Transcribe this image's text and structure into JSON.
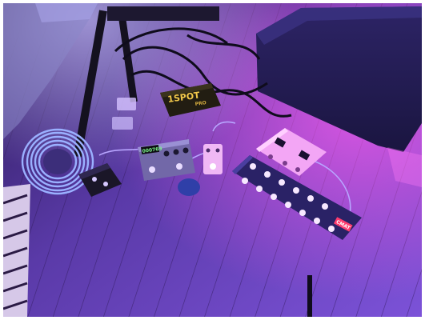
{
  "photo": {
    "subject": "pedalboard",
    "labels": {
      "power_supply": "1SPOT",
      "power_supply_sub": "PRO",
      "delay_display": "000769",
      "switcher_brand": "CMAT"
    },
    "colors": {
      "floor_dark": "#3b2277",
      "floor_light": "#7a4fd6",
      "magenta_glow": "#e04ce8",
      "pedal_pink": "#f3a6f5",
      "switch_white": "#f7e8ff",
      "dark_case": "#1b1730"
    }
  }
}
